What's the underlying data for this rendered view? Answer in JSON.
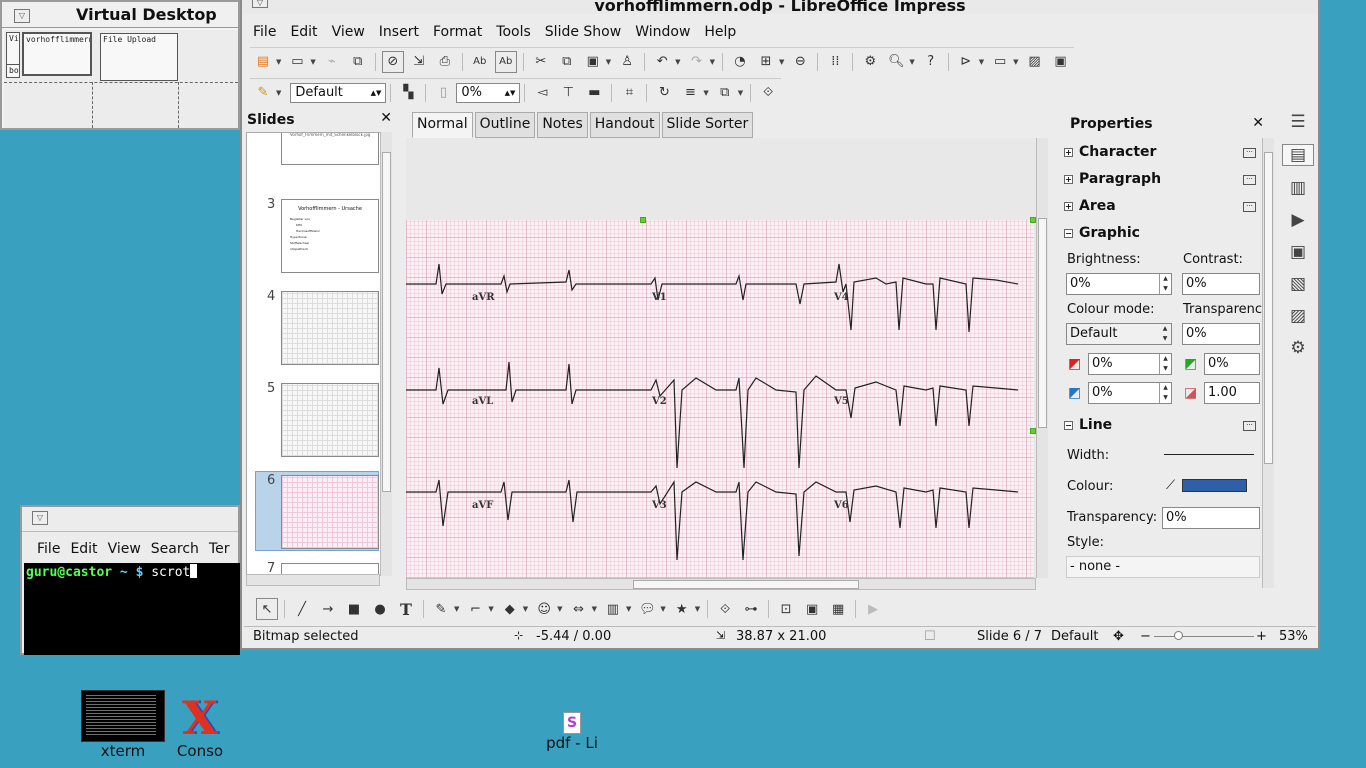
{
  "pager": {
    "title": "Virtual Desktop",
    "win1": "vorhofflimmern",
    "win2": "File Upload",
    "win3": "Vi",
    "win4": "bo"
  },
  "window": {
    "title": "vorhofflimmern.odp - LibreOffice Impress"
  },
  "menu": [
    "File",
    "Edit",
    "View",
    "Insert",
    "Format",
    "Tools",
    "Slide Show",
    "Window",
    "Help"
  ],
  "toolbar2": {
    "style_value": "Default",
    "transparency_value": "0%"
  },
  "slides_pane": {
    "title": "Slides",
    "close": "✕",
    "slides": [
      {
        "num": "3",
        "title": "Vorhofflimmern - Ursache",
        "lines": [
          "Begleiter von",
          "KHK",
          "Herzinsuffizienz",
          "Hypertonie",
          "Stoffwechsel",
          "idiopathisch"
        ]
      },
      {
        "num": "4"
      },
      {
        "num": "5"
      },
      {
        "num": "6"
      },
      {
        "num": "7"
      }
    ],
    "slide2_caption": "Vorhof_Flimmern_mit_Schenkelblock.jpg"
  },
  "view_tabs": [
    "Normal",
    "Outline",
    "Notes",
    "Handout",
    "Slide Sorter"
  ],
  "ecg_leads": [
    "aVR",
    "V1",
    "V4",
    "aVL",
    "V2",
    "V5",
    "aVF",
    "V3",
    "V6"
  ],
  "properties": {
    "title": "Properties",
    "close": "✕",
    "sections": [
      "Character",
      "Paragraph",
      "Area",
      "Graphic",
      "Line"
    ],
    "brightness_label": "Brightness:",
    "brightness": "0%",
    "contrast_label": "Contrast:",
    "contrast": "0%",
    "colour_mode_label": "Colour mode:",
    "colour_mode": "Default",
    "transparency_label": "Transparency",
    "transparency": "0%",
    "red": "0%",
    "green": "0%",
    "blue": "0%",
    "gamma": "1.00",
    "width_label": "Width:",
    "colour_label": "Colour:",
    "line_transparency_label": "Transparency:",
    "line_transparency": "0%",
    "style_label": "Style:",
    "style_value": "- none -",
    "line_colour": "#2f5fa8"
  },
  "status": {
    "selection": "Bitmap selected",
    "position": "-5.44 / 0.00",
    "size": "38.87 x 21.00",
    "slide": "Slide 6 / 7",
    "master": "Default",
    "zoom": "53%"
  },
  "terminal": {
    "menu": [
      "File",
      "Edit",
      "View",
      "Search",
      "Ter"
    ],
    "prompt_user": "guru@castor",
    "prompt_rest": " ~ $ ",
    "command": "scrot"
  },
  "desktop_icons": [
    {
      "label": "xterm"
    },
    {
      "label": "Conso"
    },
    {
      "label": "pdf - Li"
    }
  ]
}
